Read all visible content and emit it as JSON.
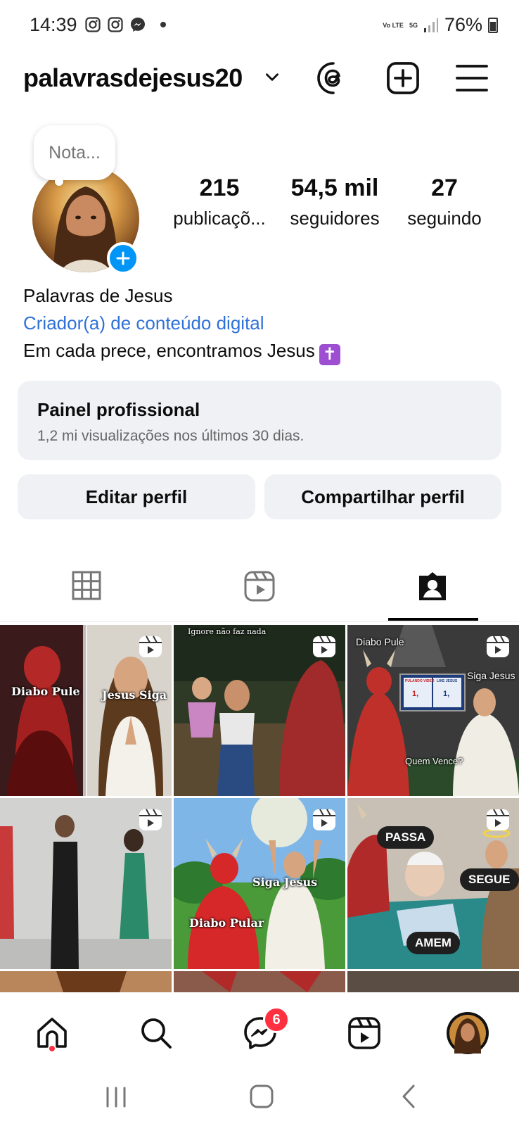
{
  "status_bar": {
    "time": "14:39",
    "network_top": "Vo LTE",
    "network_5g": "5G",
    "battery": "76%"
  },
  "header": {
    "username": "palavrasdejesus20",
    "icons": [
      "threads-icon",
      "create-post-icon",
      "menu-icon"
    ]
  },
  "profile": {
    "note_placeholder": "Nota...",
    "stats": [
      {
        "value": "215",
        "label": "publicaçõ..."
      },
      {
        "value": "54,5 mil",
        "label": "seguidores"
      },
      {
        "value": "27",
        "label": "seguindo"
      }
    ],
    "name": "Palavras de Jesus",
    "category": "Criador(a) de conteúdo digital",
    "bio": "Em cada prece, encontramos Jesus",
    "bio_emoji": "✝"
  },
  "professional_panel": {
    "title": "Painel profissional",
    "subtitle": "1,2 mi visualizações nos últimos 30 dias."
  },
  "actions": {
    "edit": "Editar perfil",
    "share": "Compartilhar perfil"
  },
  "tabs": [
    "grid-tab",
    "reels-tab",
    "tagged-tab"
  ],
  "grid": {
    "posts": [
      {
        "captions": [
          "Diabo Pule",
          "Jesus Siga"
        ]
      },
      {
        "captions": [
          "Ignore não faz nada"
        ]
      },
      {
        "captions": [
          "Diabo Pule",
          "Siga Jesus",
          "Quem Vence?",
          "PULANDO VIDEO",
          "LIKE JESUS",
          "1,",
          "1,"
        ]
      },
      {
        "captions": []
      },
      {
        "captions": [
          "Siga Jesus",
          "Diabo Pular"
        ]
      },
      {
        "captions": [
          "PASSA",
          "SEGUE",
          "AMEM"
        ]
      }
    ]
  },
  "bottom_nav": {
    "messages_badge": "6"
  },
  "colors": {
    "accent_blue": "#0095f6",
    "link_blue": "#2f71d8",
    "badge_red": "#ff3040",
    "panel_bg": "#eff1f4"
  }
}
